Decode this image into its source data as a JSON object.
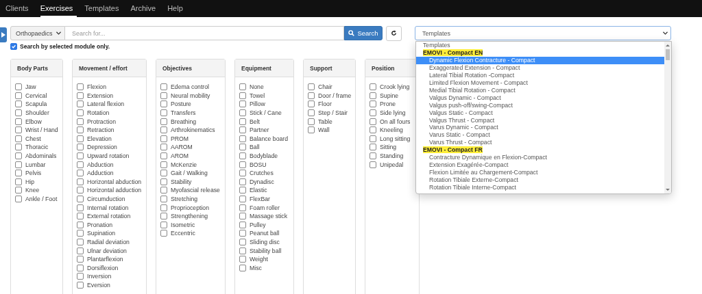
{
  "nav": {
    "items": [
      {
        "label": "Clients",
        "selected": false
      },
      {
        "label": "Exercises",
        "selected": true
      },
      {
        "label": "Templates",
        "selected": false
      },
      {
        "label": "Archive",
        "selected": false
      },
      {
        "label": "Help",
        "selected": false
      }
    ]
  },
  "search_bar": {
    "module_select": {
      "value": "Orthopaedics"
    },
    "search": {
      "placeholder": "Search for..."
    },
    "search_button": {
      "label": "Search"
    },
    "module_only": {
      "label": "Search by selected module only.",
      "checked": true
    }
  },
  "template_select": {
    "value": "Templates",
    "expanded": true,
    "options": [
      {
        "kind": "option",
        "label": "Templates",
        "highlighted": false
      },
      {
        "kind": "group",
        "label": "EMOVI - Compact EN",
        "highlighted": false
      },
      {
        "kind": "option",
        "label": "Dynamic Flexion Contracture - Compact",
        "highlighted": true
      },
      {
        "kind": "option",
        "label": "Exaggerated Extension - Compact",
        "highlighted": false
      },
      {
        "kind": "option",
        "label": "Lateral Tibial Rotation -Compact",
        "highlighted": false
      },
      {
        "kind": "option",
        "label": "Limited Flexion Movement - Compact",
        "highlighted": false
      },
      {
        "kind": "option",
        "label": "Medial Tibial Rotation - Compact",
        "highlighted": false
      },
      {
        "kind": "option",
        "label": "Valgus Dynamic - Compact",
        "highlighted": false
      },
      {
        "kind": "option",
        "label": "Valgus push-off/swing-Compact",
        "highlighted": false
      },
      {
        "kind": "option",
        "label": "Valgus Static - Compact",
        "highlighted": false
      },
      {
        "kind": "option",
        "label": "Valgus Thrust - Compact",
        "highlighted": false
      },
      {
        "kind": "option",
        "label": "Varus Dynamic - Compact",
        "highlighted": false
      },
      {
        "kind": "option",
        "label": "Varus Static - Compact",
        "highlighted": false
      },
      {
        "kind": "option",
        "label": "Varus Thrust - Compact",
        "highlighted": false
      },
      {
        "kind": "group",
        "label": "EMOVI - Compact FR",
        "highlighted": false
      },
      {
        "kind": "option",
        "label": "Contracture Dynamique en Flexion-Compact",
        "highlighted": false
      },
      {
        "kind": "option",
        "label": "Extension Exagérée-Compact",
        "highlighted": false
      },
      {
        "kind": "option",
        "label": "Flexion Limitée au Chargement-Compact",
        "highlighted": false
      },
      {
        "kind": "option",
        "label": "Rotation Tibiale Externe-Compact",
        "highlighted": false
      },
      {
        "kind": "option",
        "label": "Rotation Tibiale Interne-Compact",
        "highlighted": false
      }
    ]
  },
  "panels": [
    {
      "title": "Body Parts",
      "items": [
        {
          "label": "Jaw",
          "checked": false
        },
        {
          "label": "Cervical",
          "checked": false
        },
        {
          "label": "Scapula",
          "checked": false
        },
        {
          "label": "Shoulder",
          "checked": false
        },
        {
          "label": "Elbow",
          "checked": false
        },
        {
          "label": "Wrist / Hand",
          "checked": false
        },
        {
          "label": "Chest",
          "checked": false
        },
        {
          "label": "Thoracic",
          "checked": false
        },
        {
          "label": "Abdominals",
          "checked": false
        },
        {
          "label": "Lumbar",
          "checked": false
        },
        {
          "label": "Pelvis",
          "checked": false
        },
        {
          "label": "Hip",
          "checked": false
        },
        {
          "label": "Knee",
          "checked": false
        },
        {
          "label": "Ankle / Foot",
          "checked": false
        }
      ]
    },
    {
      "title": "Movement / effort",
      "items": [
        {
          "label": "Flexion",
          "checked": false
        },
        {
          "label": "Extension",
          "checked": false
        },
        {
          "label": "Lateral flexion",
          "checked": false
        },
        {
          "label": "Rotation",
          "checked": false
        },
        {
          "label": "Protraction",
          "checked": false
        },
        {
          "label": "Retraction",
          "checked": false
        },
        {
          "label": "Elevation",
          "checked": false
        },
        {
          "label": "Depression",
          "checked": false
        },
        {
          "label": "Upward rotation",
          "checked": false
        },
        {
          "label": "Abduction",
          "checked": false
        },
        {
          "label": "Adduction",
          "checked": false
        },
        {
          "label": "Horizontal abduction",
          "checked": false
        },
        {
          "label": "Horizontal adduction",
          "checked": false
        },
        {
          "label": "Circumduction",
          "checked": false
        },
        {
          "label": "Internal rotation",
          "checked": false
        },
        {
          "label": "External rotation",
          "checked": false
        },
        {
          "label": "Pronation",
          "checked": false
        },
        {
          "label": "Supination",
          "checked": false
        },
        {
          "label": "Radial deviation",
          "checked": false
        },
        {
          "label": "Ulnar deviation",
          "checked": false
        },
        {
          "label": "Plantarflexion",
          "checked": false
        },
        {
          "label": "Dorsiflexion",
          "checked": false
        },
        {
          "label": "Inversion",
          "checked": false
        },
        {
          "label": "Eversion",
          "checked": false
        }
      ]
    },
    {
      "title": "Objectives",
      "items": [
        {
          "label": "Edema control",
          "checked": false
        },
        {
          "label": "Neural mobility",
          "checked": false
        },
        {
          "label": "Posture",
          "checked": false
        },
        {
          "label": "Transfers",
          "checked": false
        },
        {
          "label": "Breathing",
          "checked": false
        },
        {
          "label": "Arthrokinematics",
          "checked": false
        },
        {
          "label": "PROM",
          "checked": false
        },
        {
          "label": "AAROM",
          "checked": false
        },
        {
          "label": "AROM",
          "checked": false
        },
        {
          "label": "McKenzie",
          "checked": false
        },
        {
          "label": "Gait / Walking",
          "checked": false
        },
        {
          "label": "Stability",
          "checked": false
        },
        {
          "label": "Myofascial release",
          "checked": false
        },
        {
          "label": "Stretching",
          "checked": false
        },
        {
          "label": "Proprioception",
          "checked": false
        },
        {
          "label": "Strengthening",
          "checked": false
        },
        {
          "label": "Isometric",
          "checked": false
        },
        {
          "label": "Eccentric",
          "checked": false
        }
      ]
    },
    {
      "title": "Equipment",
      "items": [
        {
          "label": "None",
          "checked": false
        },
        {
          "label": "Towel",
          "checked": false
        },
        {
          "label": "Pillow",
          "checked": false
        },
        {
          "label": "Stick / Cane",
          "checked": false
        },
        {
          "label": "Belt",
          "checked": false
        },
        {
          "label": "Partner",
          "checked": false
        },
        {
          "label": "Balance board",
          "checked": false
        },
        {
          "label": "Ball",
          "checked": false
        },
        {
          "label": "Bodyblade",
          "checked": false
        },
        {
          "label": "BOSU",
          "checked": false
        },
        {
          "label": "Crutches",
          "checked": false
        },
        {
          "label": "Dynadisc",
          "checked": false
        },
        {
          "label": "Elastic",
          "checked": false
        },
        {
          "label": "FlexBar",
          "checked": false
        },
        {
          "label": "Foam roller",
          "checked": false
        },
        {
          "label": "Massage stick",
          "checked": false
        },
        {
          "label": "Pulley",
          "checked": false
        },
        {
          "label": "Peanut ball",
          "checked": false
        },
        {
          "label": "Sliding disc",
          "checked": false
        },
        {
          "label": "Stability ball",
          "checked": false
        },
        {
          "label": "Weight",
          "checked": false
        },
        {
          "label": "Misc",
          "checked": false
        }
      ]
    },
    {
      "title": "Support",
      "items": [
        {
          "label": "Chair",
          "checked": false
        },
        {
          "label": "Door / frame",
          "checked": false
        },
        {
          "label": "Floor",
          "checked": false
        },
        {
          "label": "Step / Stair",
          "checked": false
        },
        {
          "label": "Table",
          "checked": false
        },
        {
          "label": "Wall",
          "checked": false
        }
      ]
    },
    {
      "title": "Position",
      "items": [
        {
          "label": "Crook lying",
          "checked": false
        },
        {
          "label": "Supine",
          "checked": false
        },
        {
          "label": "Prone",
          "checked": false
        },
        {
          "label": "Side lying",
          "checked": false
        },
        {
          "label": "On all fours",
          "checked": false
        },
        {
          "label": "Kneeling",
          "checked": false
        },
        {
          "label": "Long sitting",
          "checked": false
        },
        {
          "label": "Sitting",
          "checked": false
        },
        {
          "label": "Standing",
          "checked": false
        },
        {
          "label": "Unipedal",
          "checked": false
        }
      ]
    }
  ]
}
